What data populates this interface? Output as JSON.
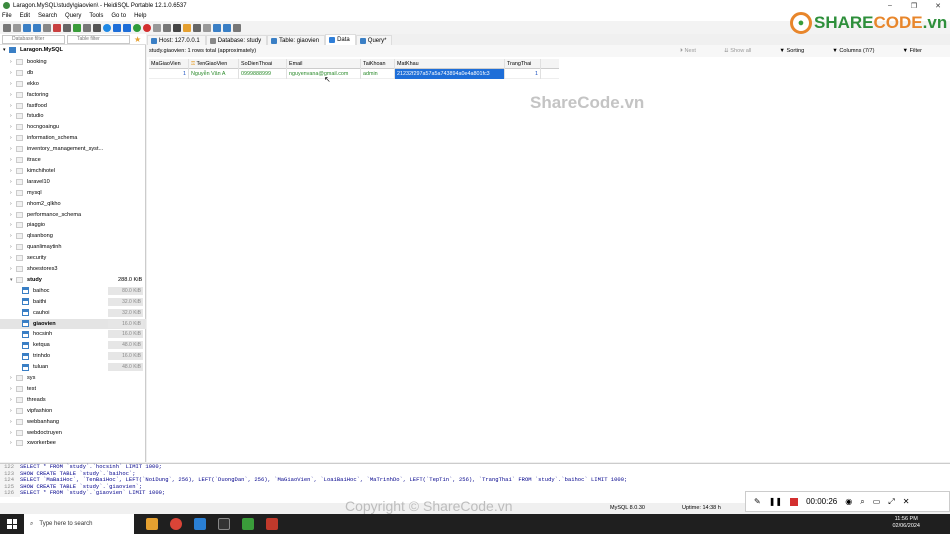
{
  "window": {
    "title": "Laragon.MySQL\\study\\giaovien\\ - HeidiSQL Portable 12.1.0.6537"
  },
  "window_controls": [
    "–",
    "❐",
    "✕"
  ],
  "menu": [
    "File",
    "Edit",
    "Search",
    "Query",
    "Tools",
    "Go to",
    "Help"
  ],
  "logo": {
    "brand": "SHARE",
    "brand2": "CODE",
    "tld": ".vn"
  },
  "filters": {
    "db_placeholder": "Database filter",
    "table_placeholder": "Table filter"
  },
  "tabs": [
    {
      "label": "Host: 127.0.0.1",
      "color": "#3a7fc5"
    },
    {
      "label": "Database: study",
      "color": "#888888"
    },
    {
      "label": "Table: giaovien",
      "color": "#3a7fc5"
    },
    {
      "label": "Data",
      "color": "#2f7ed8"
    },
    {
      "label": "Query*",
      "color": "#3a7fc5"
    }
  ],
  "tree": {
    "root": "Laragon.MySQL",
    "databases": [
      "booking",
      "db",
      "ekko",
      "factoring",
      "fastfood",
      "fstudio",
      "hocngoaingu",
      "information_schema",
      "inventory_management_syst...",
      "itrace",
      "kimchihotel",
      "laravel10",
      "mysql",
      "nhom2_qlkho",
      "performance_schema",
      "piaggio",
      "qlsanbong",
      "quanlimaytinh",
      "security",
      "shoestores3"
    ],
    "study": {
      "name": "study",
      "size": "288.0 KiB"
    },
    "tables": [
      {
        "name": "baihoc",
        "size": "80.0 KiB"
      },
      {
        "name": "baithi",
        "size": "32.0 KiB"
      },
      {
        "name": "cauhoi",
        "size": "32.0 KiB"
      },
      {
        "name": "giaovien",
        "size": "16.0 KiB"
      },
      {
        "name": "hocsinh",
        "size": "16.0 KiB"
      },
      {
        "name": "ketqua",
        "size": "48.0 KiB"
      },
      {
        "name": "trinhdo",
        "size": "16.0 KiB"
      },
      {
        "name": "tuluan",
        "size": "48.0 KiB"
      }
    ],
    "more": [
      "sys",
      "test",
      "threads",
      "vipfashion",
      "webbanhang",
      "webdoctruyen",
      "xworkerbee"
    ]
  },
  "data_header": {
    "info": "study.giaovien: 1 rows total (approximately)",
    "next": "Next",
    "show_all": "Show all",
    "sorting": "Sorting",
    "columns": "Columns (7/7)",
    "filter": "Filter"
  },
  "grid": {
    "columns": [
      "MaGiaoVien",
      "TenGiaoVien",
      "SoDienThoai",
      "Email",
      "TaiKhoan",
      "MatKhau",
      "TrangThai"
    ],
    "rows": [
      [
        "1",
        "Nguyễn Văn A",
        "0999888999",
        "nguyenvana@gmail.com",
        "admin",
        "21232f297a57a5a743894a0e4a801fc3",
        "1"
      ]
    ]
  },
  "watermark": "ShareCode.vn",
  "editor": {
    "lines": [
      {
        "n": "122",
        "code": "SELECT * FROM `study`.`hocsinh` LIMIT 1000;"
      },
      {
        "n": "123",
        "code": "SHOW CREATE TABLE `study`.`baihoc`;"
      },
      {
        "n": "124",
        "code": "SELECT `MaBaiHoc`, `TenBaiHoc`, LEFT(`NoiDung`, 256), LEFT(`DuongDan`, 256), `MaGiaoVien`, `LoaiBaiHoc`, `MaTrinhDo`, LEFT(`TepTin`, 256), `TrangThai` FROM `study`.`baihoc` LIMIT 1000;"
      },
      {
        "n": "125",
        "code": "SHOW CREATE TABLE `study`.`giaovien`;"
      },
      {
        "n": "126",
        "code": "SELECT * FROM `study`.`giaovien` LIMIT 1000;"
      }
    ]
  },
  "statusbar": {
    "version": "MySQL 8.0.30",
    "uptime": "Uptime: 14:38 h"
  },
  "copyright": "Copyright © ShareCode.vn",
  "recorder": {
    "time": "00:00:26"
  },
  "taskbar": {
    "search_placeholder": "Type here to search",
    "time": "11:56 PM",
    "date": "02/06/2024"
  }
}
